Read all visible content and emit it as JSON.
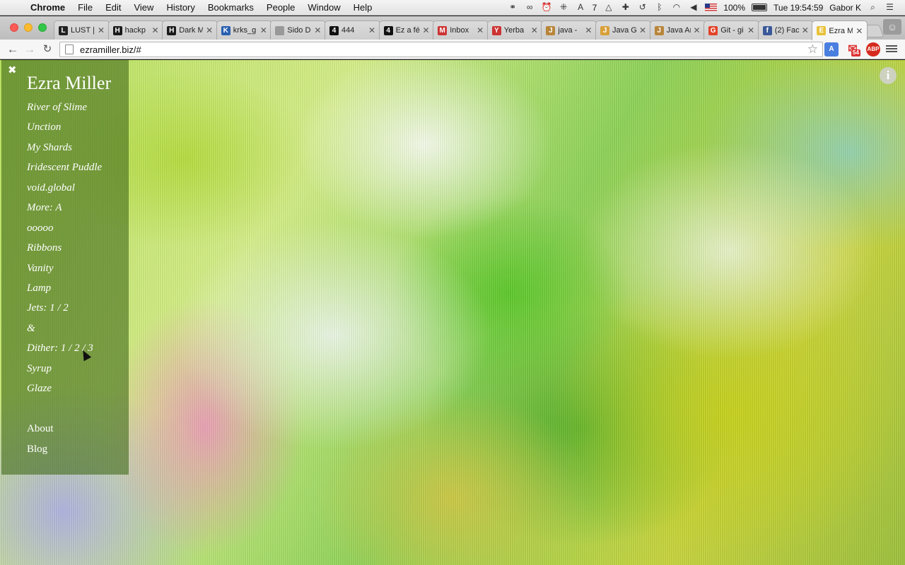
{
  "menubar": {
    "app": "Chrome",
    "items": [
      "File",
      "Edit",
      "View",
      "History",
      "Bookmarks",
      "People",
      "Window",
      "Help"
    ],
    "adobe_count": "7",
    "battery": "100%",
    "clock": "Tue 19:54:59",
    "user": "Gabor K"
  },
  "tabs": [
    {
      "label": "LUST |",
      "favicon": "L"
    },
    {
      "label": "hackp",
      "favicon": "H"
    },
    {
      "label": "Dark M",
      "favicon": "H"
    },
    {
      "label": "krks_g",
      "favicon": "K"
    },
    {
      "label": "Sido D",
      "favicon": ""
    },
    {
      "label": "444",
      "favicon": "4"
    },
    {
      "label": "Ez a fé",
      "favicon": "4"
    },
    {
      "label": "Inbox",
      "favicon": "M"
    },
    {
      "label": "Yerba",
      "favicon": "Y"
    },
    {
      "label": "java -",
      "favicon": "J"
    },
    {
      "label": "Java Ge",
      "favicon": "J"
    },
    {
      "label": "Java Ar",
      "favicon": "J"
    },
    {
      "label": "Git - gi",
      "favicon": "G"
    },
    {
      "label": "(2) Fac",
      "favicon": "f"
    },
    {
      "label": "Ezra M",
      "favicon": "E",
      "active": true
    }
  ],
  "toolbar": {
    "url": "ezramiller.biz/#",
    "mail_badge": "54",
    "abp_label": "ABP"
  },
  "site": {
    "title": "Ezra Miller",
    "close_glyph": "✖",
    "works": [
      "River of Slime",
      "Unction",
      "My Shards",
      "Iridescent Puddle",
      "void.global",
      "More: A",
      "ooooo",
      "Ribbons",
      "Vanity",
      "Lamp",
      "Jets: 1 / 2",
      "&",
      "Dither: 1 / 2 / 3",
      "Syrup",
      "Glaze"
    ],
    "pages": [
      "About",
      "Blog"
    ],
    "info_glyph": "i"
  }
}
